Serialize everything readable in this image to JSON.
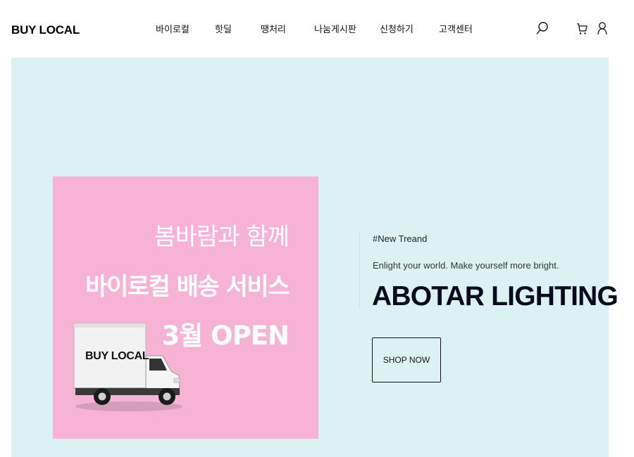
{
  "header": {
    "logo": "BUY LOCAL",
    "nav": [
      "바이로컬",
      "핫딜",
      "땡처리",
      "나눔게시판",
      "신청하기",
      "고객센터"
    ],
    "icons": [
      "search-icon",
      "cart-icon",
      "user-icon"
    ]
  },
  "hero": {
    "banner": {
      "line1": "봄바람과 함께",
      "line2": "바이로컬 배송 서비스",
      "line3": "3월 OPEN",
      "truck_label": "BUY LOCAL"
    },
    "tag": "#New Treand",
    "subtitle": "Enlight your world. Make yourself more bright.",
    "headline": "ABOTAR LIGHTING",
    "cta": "SHOP NOW"
  },
  "colors": {
    "hero_bg": "#dcf2f2",
    "banner_bg": "#f6b3d6",
    "headline": "#0a0a1f"
  }
}
